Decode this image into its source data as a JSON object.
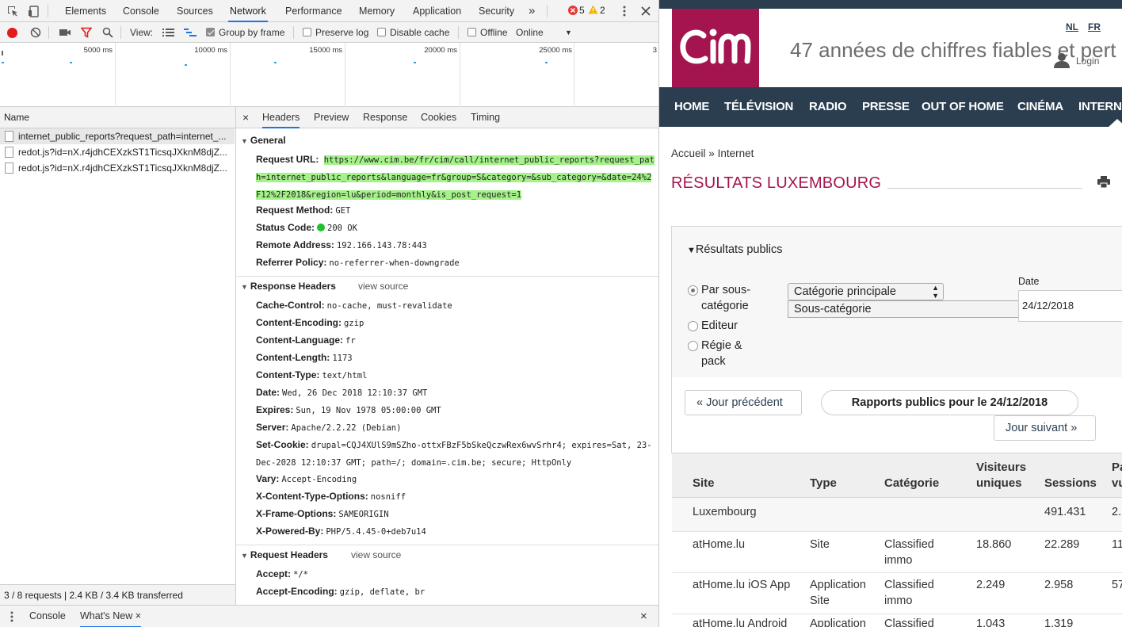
{
  "devtools": {
    "tabs": [
      "Elements",
      "Console",
      "Sources",
      "Network",
      "Performance",
      "Memory",
      "Application",
      "Security"
    ],
    "more_tabs": "»",
    "errors": "5",
    "warnings": "2",
    "toolbar": {
      "view_label": "View:",
      "group_by_frame": "Group by frame",
      "preserve_log": "Preserve log",
      "disable_cache": "Disable cache",
      "offline": "Offline",
      "throttle": "Online"
    },
    "timeline": {
      "ticks": [
        "5000 ms",
        "10000 ms",
        "15000 ms",
        "20000 ms",
        "25000 ms",
        "3"
      ]
    },
    "request_list": {
      "header": "Name",
      "rows": [
        "internet_public_reports?request_path=internet_...",
        "redot.js?id=nX.r4jdhCEXzkST1TicsqJXknM8djZ...",
        "redot.js?id=nX.r4jdhCEXzkST1TicsqJXknM8djZ..."
      ],
      "status": "3 / 8 requests | 2.4 KB / 3.4 KB transferred"
    },
    "detail": {
      "close": "×",
      "tabs": [
        "Headers",
        "Preview",
        "Response",
        "Cookies",
        "Timing"
      ],
      "general": {
        "title": "General",
        "rows": [
          {
            "k": "Request URL:",
            "v": "https://www.cim.be/fr/cim/call/internet_public_reports?request_path=internet_public_reports&language=fr&group=S&category=&sub_category=&date=24%2F12%2F2018&region=lu&period=monthly&is_post_request=1"
          },
          {
            "k": "Request Method:",
            "v": "GET"
          },
          {
            "k": "Status Code:",
            "v": "200 OK"
          },
          {
            "k": "Remote Address:",
            "v": "192.166.143.78:443"
          },
          {
            "k": "Referrer Policy:",
            "v": "no-referrer-when-downgrade"
          }
        ]
      },
      "response_headers": {
        "title": "Response Headers",
        "link": "view source",
        "rows": [
          {
            "k": "Cache-Control:",
            "v": "no-cache, must-revalidate"
          },
          {
            "k": "Content-Encoding:",
            "v": "gzip"
          },
          {
            "k": "Content-Language:",
            "v": "fr"
          },
          {
            "k": "Content-Length:",
            "v": "1173"
          },
          {
            "k": "Content-Type:",
            "v": "text/html"
          },
          {
            "k": "Date:",
            "v": "Wed, 26 Dec 2018 12:10:37 GMT"
          },
          {
            "k": "Expires:",
            "v": "Sun, 19 Nov 1978 05:00:00 GMT"
          },
          {
            "k": "Server:",
            "v": "Apache/2.2.22 (Debian)"
          },
          {
            "k": "Set-Cookie:",
            "v": "drupal=CQJ4XUlS9mSZho-ottxFBzF5bSkeQczwRex6wvSrhr4; expires=Sat, 23-Dec-2028 12:10:37 GMT; path=/; domain=.cim.be; secure; HttpOnly"
          },
          {
            "k": "Vary:",
            "v": "Accept-Encoding"
          },
          {
            "k": "X-Content-Type-Options:",
            "v": "nosniff"
          },
          {
            "k": "X-Frame-Options:",
            "v": "SAMEORIGIN"
          },
          {
            "k": "X-Powered-By:",
            "v": "PHP/5.4.45-0+deb7u14"
          }
        ]
      },
      "request_headers": {
        "title": "Request Headers",
        "link": "view source",
        "rows": [
          {
            "k": "Accept:",
            "v": "*/*"
          },
          {
            "k": "Accept-Encoding:",
            "v": "gzip, deflate, br"
          }
        ]
      }
    },
    "drawer": {
      "tabs": [
        "Console",
        "What's New"
      ],
      "close_tab": "×",
      "close": "×"
    }
  },
  "site": {
    "logo_text": "cim",
    "tagline": "47 années de chiffres fiables et pert",
    "lang_nl": "NL",
    "lang_fr": "FR",
    "login": "Login",
    "nav": [
      "HOME",
      "TÉLÉVISION",
      "RADIO",
      "PRESSE",
      "OUT OF HOME",
      "CINÉMA",
      "INTERN"
    ],
    "breadcrumb": {
      "home": "Accueil",
      "sep": "»",
      "current": "Internet"
    },
    "page_title": "RÉSULTATS LUXEMBOURG",
    "filter": {
      "toggle": "Résultats publics",
      "radios": [
        "Par sous-catégorie",
        "Editeur",
        "Régie & pack"
      ],
      "select_main": "Catégorie principale",
      "select_sub": "Sous-catégorie",
      "date_label": "Date",
      "date_value": "24/12/2018"
    },
    "buttons": {
      "prev": "« Jour précédent",
      "report": "Rapports publics pour le 24/12/2018",
      "next": "Jour suivant »"
    },
    "table": {
      "headers": [
        "Site",
        "Type",
        "Catégorie",
        "Visiteurs uniques",
        "Sessions",
        "Pa vu"
      ],
      "rows": [
        {
          "site": "Luxembourg",
          "type": "",
          "cat": "",
          "vis": "",
          "sess": "491.431",
          "pv": "2."
        },
        {
          "site": "atHome.lu",
          "type": "Site",
          "cat": "Classified immo",
          "vis": "18.860",
          "sess": "22.289",
          "pv": "11"
        },
        {
          "site": "atHome.lu iOS App",
          "type": "Application Site",
          "cat": "Classified immo",
          "vis": "2.249",
          "sess": "2.958",
          "pv": "57"
        },
        {
          "site": "atHome.lu Android",
          "type": "Application",
          "cat": "Classified",
          "vis": "1.043",
          "sess": "1.319",
          "pv": ""
        }
      ]
    }
  }
}
